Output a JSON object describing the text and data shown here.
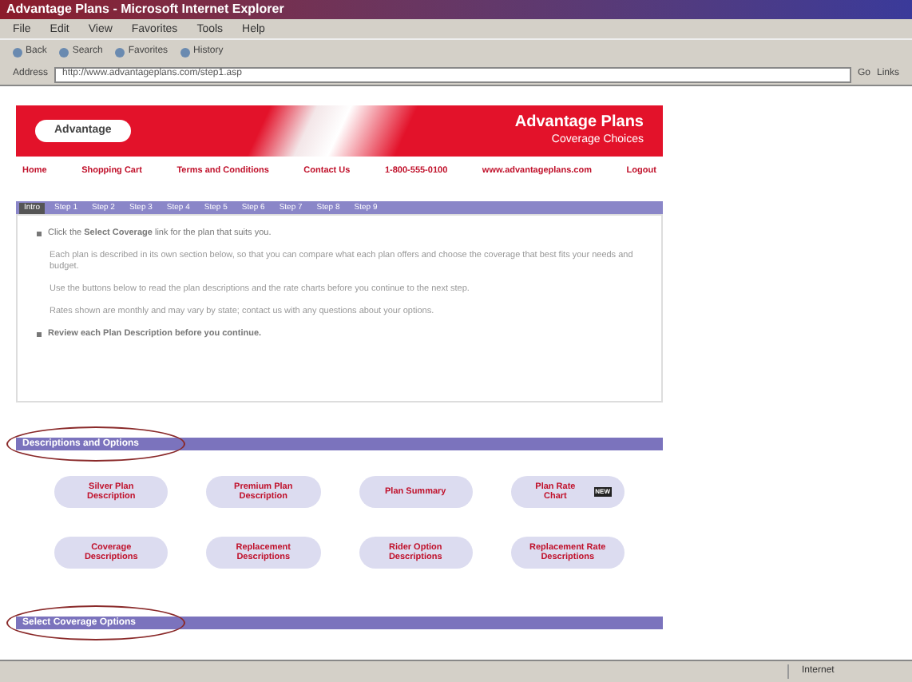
{
  "window": {
    "title": "Advantage Plans - Microsoft Internet Explorer"
  },
  "menu": [
    "File",
    "Edit",
    "View",
    "Favorites",
    "Tools",
    "Help"
  ],
  "toolbar": [
    "Back",
    "Search",
    "Favorites",
    "History"
  ],
  "address": {
    "label": "Address",
    "value": "http://www.advantageplans.com/step1.asp",
    "go": "Go",
    "links": "Links"
  },
  "banner": {
    "logo": "Advantage",
    "title": "Advantage Plans",
    "subtitle": "Coverage Choices"
  },
  "nav": [
    "Home",
    "Shopping Cart",
    "Terms and Conditions",
    "Contact Us",
    "1-800-555-0100",
    "www.advantageplans.com",
    "Logout"
  ],
  "steps": [
    {
      "label": "Intro",
      "selected": true
    },
    {
      "label": "Step 1",
      "selected": false
    },
    {
      "label": "Step 2",
      "selected": false
    },
    {
      "label": "Step 3",
      "selected": false
    },
    {
      "label": "Step 4",
      "selected": false
    },
    {
      "label": "Step 5",
      "selected": false
    },
    {
      "label": "Step 6",
      "selected": false
    },
    {
      "label": "Step 7",
      "selected": false
    },
    {
      "label": "Step 8",
      "selected": false
    },
    {
      "label": "Step 9",
      "selected": false
    }
  ],
  "intro": [
    {
      "kind": "bullet",
      "text": "Click the **Select Coverage** link for the plan that suits you."
    },
    {
      "kind": "para",
      "text": "Each plan is described in its own section below, so that you can compare what each plan offers and choose the coverage that best fits your needs and budget."
    },
    {
      "kind": "para",
      "text": "Use the buttons below to read the plan descriptions and the rate charts before you continue to the next step."
    },
    {
      "kind": "para",
      "text": "Rates shown are monthly and may vary by state; contact us with any questions about your options."
    },
    {
      "kind": "bold",
      "text": "Review each Plan Description before you continue."
    }
  ],
  "sections": [
    {
      "title": "Descriptions and Options",
      "buttons": [
        {
          "label": "Silver Plan Description"
        },
        {
          "label": "Premium Plan Description"
        },
        {
          "label": "Plan Summary"
        },
        {
          "label": "Plan Rate Chart",
          "badge": "NEW"
        },
        {
          "label": "Coverage Descriptions"
        },
        {
          "label": "Replacement Descriptions"
        },
        {
          "label": "Rider Option Descriptions"
        },
        {
          "label": "Replacement Rate Descriptions"
        }
      ]
    },
    {
      "title": "Select Coverage Options"
    }
  ],
  "status_bar": {
    "zone": "Internet"
  }
}
